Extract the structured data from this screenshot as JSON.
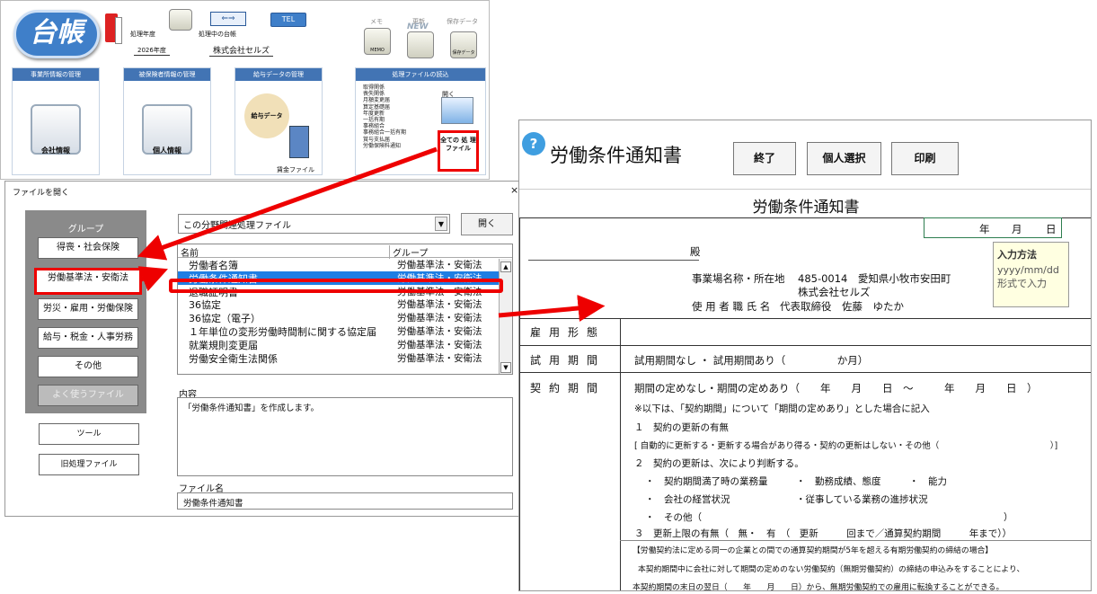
{
  "launcher": {
    "logo_text": "台帳",
    "year_label": "処理年度",
    "year_value": "2026年度",
    "ledger_label": "処理中の台帳",
    "ledger_value": "株式会社セルズ",
    "tel_label": "TEL",
    "memo_label": "メモ",
    "memo_icon_text": "MEMO",
    "update_label": "更新",
    "update_badge": "NEW",
    "save_label": "保存データ",
    "save_icon_text": "保存データ",
    "panels": [
      {
        "header": "事業所情報の管理",
        "icon_label": "会社情報"
      },
      {
        "header": "被保険者情報の管理",
        "icon_label": "個人情報"
      },
      {
        "header": "給与データの管理",
        "icon_label": "給与データ",
        "sub_label": "賃金ファイル"
      },
      {
        "header": "処理ファイルの読込"
      }
    ],
    "file_categories": [
      "取得関係",
      "喪失関係",
      "月額変更届",
      "算定基礎届",
      "年度更新",
      "一括有期",
      "事務組合",
      "事務組合一括有期",
      "賞与支払届",
      "労働保険料通知"
    ],
    "open_icon_label": "開く",
    "all_files_label": "全ての 処 理 ファイル"
  },
  "dialog": {
    "title": "ファイルを開く",
    "close": "×",
    "group_label": "グループ",
    "groups": [
      "得喪・社会保険",
      "労働基準法・安衛法",
      "労災・雇用・労働保険",
      "給与・税金・人事労務",
      "その他",
      "よく使うファイル"
    ],
    "tool_button": "ツール",
    "legacy_button": "旧処理ファイル",
    "combo_value": "この分野関連処理ファイル",
    "open_button": "開く",
    "columns": [
      "名前",
      "グループ"
    ],
    "files": [
      {
        "name": "労働者名簿",
        "group": "労働基準法・安衛法"
      },
      {
        "name": "労働条件通知書",
        "group": "労働基準法・安衛法"
      },
      {
        "name": "退職証明書",
        "group": "労働基準法・安衛法"
      },
      {
        "name": "36協定",
        "group": "労働基準法・安衛法"
      },
      {
        "name": "36協定（電子）",
        "group": "労働基準法・安衛法"
      },
      {
        "name": "１年単位の変形労働時間制に関する協定届",
        "group": "労働基準法・安衛法"
      },
      {
        "name": "就業規則変更届",
        "group": "労働基準法・安衛法"
      },
      {
        "name": "労働安全衛生法関係",
        "group": "労働基準法・安衛法"
      }
    ],
    "content_label": "内容",
    "content_text": "「労働条件通知書」を作成します。",
    "filename_label": "ファイル名",
    "filename_value": "労働条件通知書"
  },
  "form": {
    "help_icon": "?",
    "title": "労働条件通知書",
    "buttons": [
      "終了",
      "個人選択",
      "印刷"
    ],
    "subtitle": "労働条件通知書",
    "date_year": "年",
    "date_month": "月",
    "date_day": "日",
    "addressee_suffix": "殿",
    "employer_label1": "事業場名称・所在地",
    "employer_address": "485-0014　愛知県小牧市安田町",
    "employer_name": "株式会社セルズ",
    "employer_label2": "使 用 者 職 氏 名",
    "employer_person": "代表取締役　佐藤　ゆたか",
    "tooltip_title": "入力方法",
    "tooltip_text": "yyyy/mm/dd 形式で入力",
    "rows": {
      "employment_type": "雇用形態",
      "trial_label": "試用期間",
      "trial_text": "試用期間なし ・ 試用期間あり（　　　　　か月）",
      "contract_label": "契約期間"
    },
    "contract_lines": [
      "期間の定めなし・期間の定めあり（　　年　　月　　日　～　　　年　　月　　日　）",
      "※以下は、「契約期間」について「期間の定めあり」とした場合に記入",
      "１　契約の更新の有無",
      "[ 自動的に更新する・更新する場合があり得る・契約の更新はしない・その他（　　　　　　　　　　　　　）]",
      "２　契約の更新は、次により判断する。",
      "・　契約期間満了時の業務量　　　・　勤務成績、態度　　　・　能力",
      "・　会社の経営状況　　　　　　　・従事している業務の進捗状況",
      "・　その他（　　　　　　　　　　　　　　　　　　　　　　　　　　　　　　　　）",
      "３　更新上限の有無（　無・　有　（　更新　　　回まで／通算契約期間　　　年まで））",
      "【労働契約法に定める同一の企業との間での通算契約期間が5年を超える有期労働契約の締結の場合】",
      "本契約期間中に会社に対して期間の定めのない労働契約（無期労働契約）の締結の申込みをすることにより、",
      "本契約期間の末日の翌日（　　年　　月　　日）から、無期労働契約での雇用に転換することができる。"
    ]
  },
  "colors": {
    "highlight": "#e00000",
    "selection": "#1f7ee3",
    "header_blue": "#4274b4"
  }
}
